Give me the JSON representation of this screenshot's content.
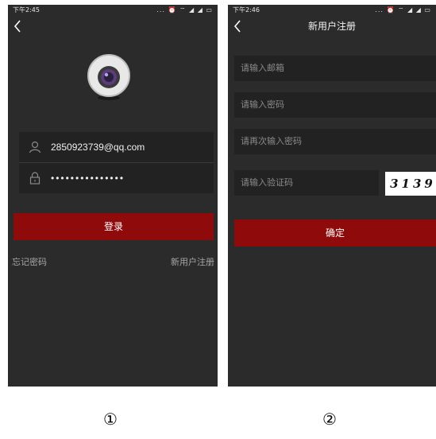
{
  "screen1": {
    "status_time": "下午2:45",
    "status_icons": "... ⏰ ⌔ ◢ ◢ ▭",
    "username": "2850923739@qq.com",
    "password": "•••••••••••••••",
    "login_button": "登录",
    "forgot_password": "忘记密码",
    "register_link": "新用户注册"
  },
  "screen2": {
    "status_time": "下午2:46",
    "status_icons": "... ⏰ ⌔ ◢ ◢ ▭",
    "title": "新用户注册",
    "email_placeholder": "请输入邮箱",
    "password_placeholder": "请输入密码",
    "password_again_placeholder": "请再次输入密码",
    "captcha_placeholder": "请输入验证码",
    "captcha_code": "3139",
    "confirm_button": "确定"
  },
  "labels": {
    "one": "①",
    "two": "②"
  },
  "colors": {
    "background": "#2b2b2b",
    "accent": "#8f0a0a"
  }
}
